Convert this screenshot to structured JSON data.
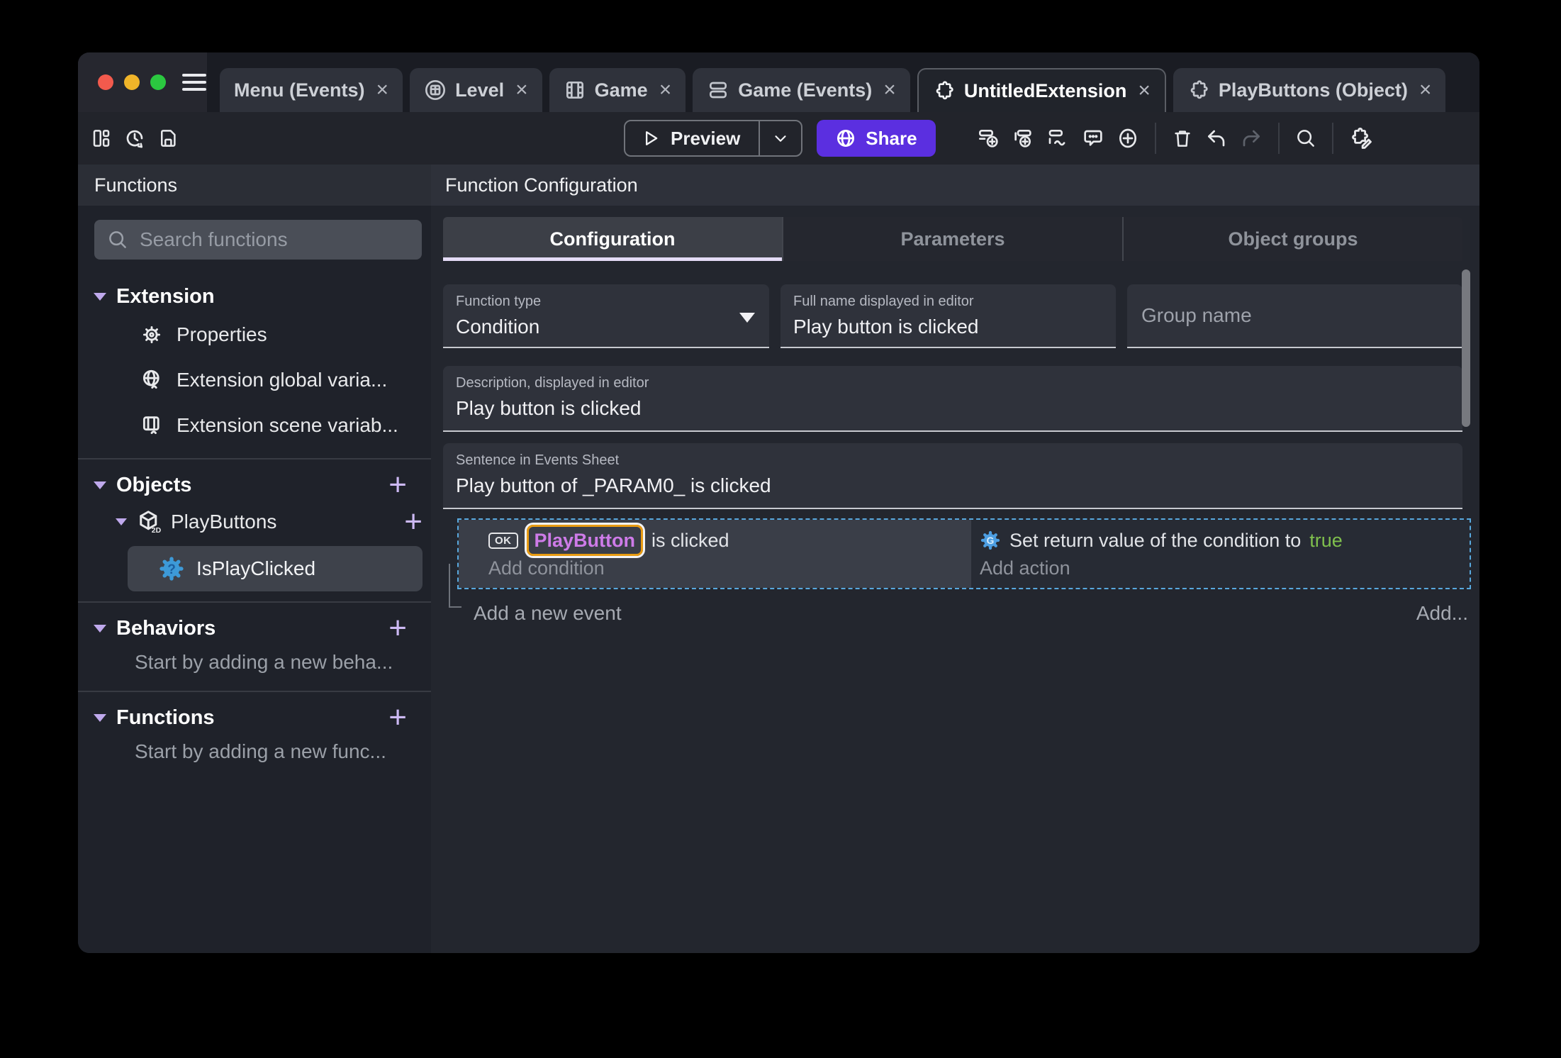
{
  "glyphs": {
    "close": "×",
    "plus": "+"
  },
  "tabs": [
    {
      "label": "Menu (Events)"
    },
    {
      "label": "Level"
    },
    {
      "label": "Game"
    },
    {
      "label": "Game (Events)"
    },
    {
      "label": "UntitledExtension"
    },
    {
      "label": "PlayButtons (Object)"
    }
  ],
  "toolbar": {
    "preview": "Preview",
    "share": "Share"
  },
  "sidebar": {
    "title": "Functions",
    "search_placeholder": "Search functions",
    "extension": {
      "label": "Extension",
      "items": [
        {
          "label": "Properties"
        },
        {
          "label": "Extension global varia..."
        },
        {
          "label": "Extension scene variab..."
        }
      ]
    },
    "objects": {
      "label": "Objects",
      "object": "PlayButtons",
      "function": "IsPlayClicked"
    },
    "behaviors": {
      "label": "Behaviors",
      "empty": "Start by adding a new beha..."
    },
    "functions": {
      "label": "Functions",
      "empty": "Start by adding a new func..."
    }
  },
  "main": {
    "title": "Function Configuration",
    "tabs": [
      {
        "label": "Configuration"
      },
      {
        "label": "Parameters"
      },
      {
        "label": "Object groups"
      }
    ],
    "fields": {
      "function_type": {
        "label": "Function type",
        "value": "Condition"
      },
      "full_name": {
        "label": "Full name displayed in editor",
        "value": "Play button is clicked"
      },
      "group_name": {
        "placeholder": "Group name"
      },
      "description": {
        "label": "Description, displayed in editor",
        "value": "Play button is clicked"
      },
      "sentence": {
        "label": "Sentence in Events Sheet",
        "value": "Play button of _PARAM0_ is clicked"
      }
    },
    "events": {
      "condition_badge": "OK",
      "condition_object": "PlayButton",
      "condition_text": "is clicked",
      "add_condition": "Add condition",
      "action_text": "Set return value of the condition to",
      "action_value": "true",
      "add_action": "Add action",
      "add_new_event": "Add a new event",
      "add_more": "Add..."
    }
  },
  "colors": {
    "share_button": "#5B2FE0",
    "accent_lavender": "#CDB9F4",
    "object_name_purple": "#CE7BE8",
    "instruction_highlight_orange": "#E89B12",
    "boolean_true_green": "#7FBF4D",
    "event_selection_blue": "#58A8DE",
    "function_icon_blue": "#3D9AD8"
  }
}
